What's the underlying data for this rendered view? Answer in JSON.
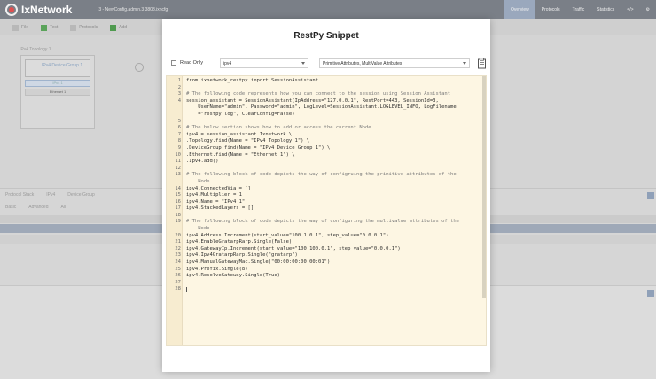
{
  "app": {
    "logo_text": "IxNetwork",
    "config_name": "3 - NewConfig.admin.3 3808.ixncfg",
    "top_tabs": [
      "Overview",
      "Protocols",
      "Traffic",
      "Statistics",
      "</>"
    ]
  },
  "toolbar": {
    "items": [
      "File",
      "Test",
      "Protocols",
      "Add"
    ]
  },
  "canvas": {
    "topology_label": "IPv4 Topology 1",
    "device_group": "IPv4 Device Group 1",
    "ipv4_chip": "IPv4 1",
    "ethernet_chip": "Ethernet 1"
  },
  "grid": {
    "tabs": [
      "Protocol Stack",
      "IPv4",
      "Device Group"
    ],
    "subtabs": [
      "Basic",
      "Advanced",
      "All"
    ]
  },
  "modal": {
    "title": "RestPy Snippet",
    "read_only_label": "Read Only",
    "object_select": "ipv4",
    "filter_select": "Primitive Attributes, MultiValue Attributes",
    "copy_icon": "clipboard-icon"
  },
  "code": [
    {
      "n": "1",
      "t": "from ixnetwork_restpy import SessionAssistant"
    },
    {
      "n": "2",
      "t": ""
    },
    {
      "n": "3",
      "t": "# The following code represents how you can connect to the session using Session Assistant"
    },
    {
      "n": "4",
      "t": "session_assistant = SessionAssistant(IpAddress=\"127.0.0.1\", RestPort=443, SessionId=3,"
    },
    {
      "n": "",
      "t": "    UserName=\"admin\", Password=\"admin\", LogLevel=SessionAssistant.LOGLEVEL_INFO, LogFilename"
    },
    {
      "n": "",
      "t": "    =\"restpy.log\", ClearConfig=False)"
    },
    {
      "n": "5",
      "t": ""
    },
    {
      "n": "6",
      "t": "# The below section shows how to add or access the current Node"
    },
    {
      "n": "7",
      "t": "ipv4 = session_assistant.Ixnetwork \\"
    },
    {
      "n": "8",
      "t": ".Topology.find(Name = \"IPv4 Topology 1\") \\"
    },
    {
      "n": "9",
      "t": ".DeviceGroup.find(Name = \"IPv4 Device Group 1\") \\"
    },
    {
      "n": "10",
      "t": ".Ethernet.find(Name = \"Ethernet 1\") \\"
    },
    {
      "n": "11",
      "t": ".Ipv4.add()"
    },
    {
      "n": "12",
      "t": ""
    },
    {
      "n": "13",
      "t": "# The following block of code depicts the way of configruing the primitive attributes of the"
    },
    {
      "n": "",
      "t": "    Node"
    },
    {
      "n": "14",
      "t": "ipv4.ConnectedVia = []"
    },
    {
      "n": "15",
      "t": "ipv4.Multiplier = 1"
    },
    {
      "n": "16",
      "t": "ipv4.Name = \"IPv4 1\""
    },
    {
      "n": "17",
      "t": "ipv4.StackedLayers = []"
    },
    {
      "n": "18",
      "t": ""
    },
    {
      "n": "19",
      "t": "# The following block of code depicts the way of configuring the multivalue attributes of the"
    },
    {
      "n": "",
      "t": "    Node"
    },
    {
      "n": "20",
      "t": "ipv4.Address.Increment(start_value=\"100.1.0.1\", step_value=\"0.0.0.1\")"
    },
    {
      "n": "21",
      "t": "ipv4.EnableGratarpRarp.Single(False)"
    },
    {
      "n": "22",
      "t": "ipv4.GatewayIp.Increment(start_value=\"100.100.0.1\", step_value=\"0.0.0.1\")"
    },
    {
      "n": "23",
      "t": "ipv4.Ipv4GratarpRarp.Single(\"gratarp\")"
    },
    {
      "n": "24",
      "t": "ipv4.ManualGatewayMac.Single(\"00:00:00:00:00:01\")"
    },
    {
      "n": "25",
      "t": "ipv4.Prefix.Single(8)"
    },
    {
      "n": "26",
      "t": "ipv4.ResolveGateway.Single(True)"
    },
    {
      "n": "27",
      "t": ""
    },
    {
      "n": "28",
      "t": ""
    }
  ]
}
